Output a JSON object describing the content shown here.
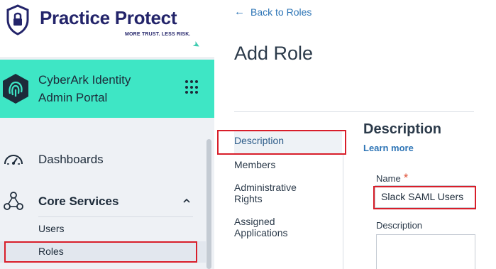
{
  "brand": {
    "name": "Practice Protect",
    "tagline": "MORE TRUST. LESS RISK."
  },
  "portal": {
    "title": "CyberArk Identity Admin Portal"
  },
  "nav": {
    "dashboards": "Dashboards",
    "core_services": "Core Services",
    "sub_items": {
      "users": "Users",
      "roles": "Roles"
    }
  },
  "main": {
    "back_link": "Back to Roles",
    "page_title": "Add Role",
    "tabs": {
      "description": "Description",
      "members": "Members",
      "administrative_rights": "Administrative Rights",
      "assigned_applications": "Assigned Applications"
    },
    "section_title": "Description",
    "learn_more": "Learn more",
    "name_label": "Name",
    "required_marker": "*",
    "name_value": "Slack SAML Users",
    "description_label": "Description"
  },
  "colors": {
    "accent_teal": "#3ee6c5",
    "brand_navy": "#23246a",
    "link_blue": "#2e75b6",
    "highlight_red": "#d81e2a"
  }
}
